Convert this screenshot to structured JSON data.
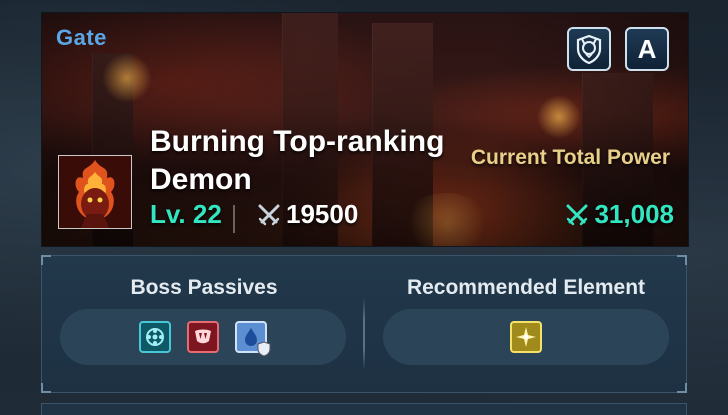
{
  "banner": {
    "gate_label": "Gate",
    "boss_name": "Burning Top-ranking Demon",
    "level_label": "Lv. 22",
    "boss_power": "19500",
    "current_total_power_label": "Current Total Power",
    "current_total_power_value": "31,008",
    "auto_button_label": "A"
  },
  "panel": {
    "boss_passives_title": "Boss Passives",
    "recommended_element_title": "Recommended Element",
    "boss_passives": [
      {
        "icon": "gear-passive-icon",
        "color": "#48c8d6"
      },
      {
        "icon": "fang-passive-icon",
        "color": "#e56a72"
      },
      {
        "icon": "water-shield-passive-icon",
        "color": "#5b8fd1"
      }
    ],
    "recommended_element": {
      "icon": "light-element-icon",
      "color": "#f3e16a"
    }
  },
  "colors": {
    "accent_teal": "#33e6c2",
    "label_gold": "#e8d08a",
    "gate_blue": "#5aa6e6"
  }
}
